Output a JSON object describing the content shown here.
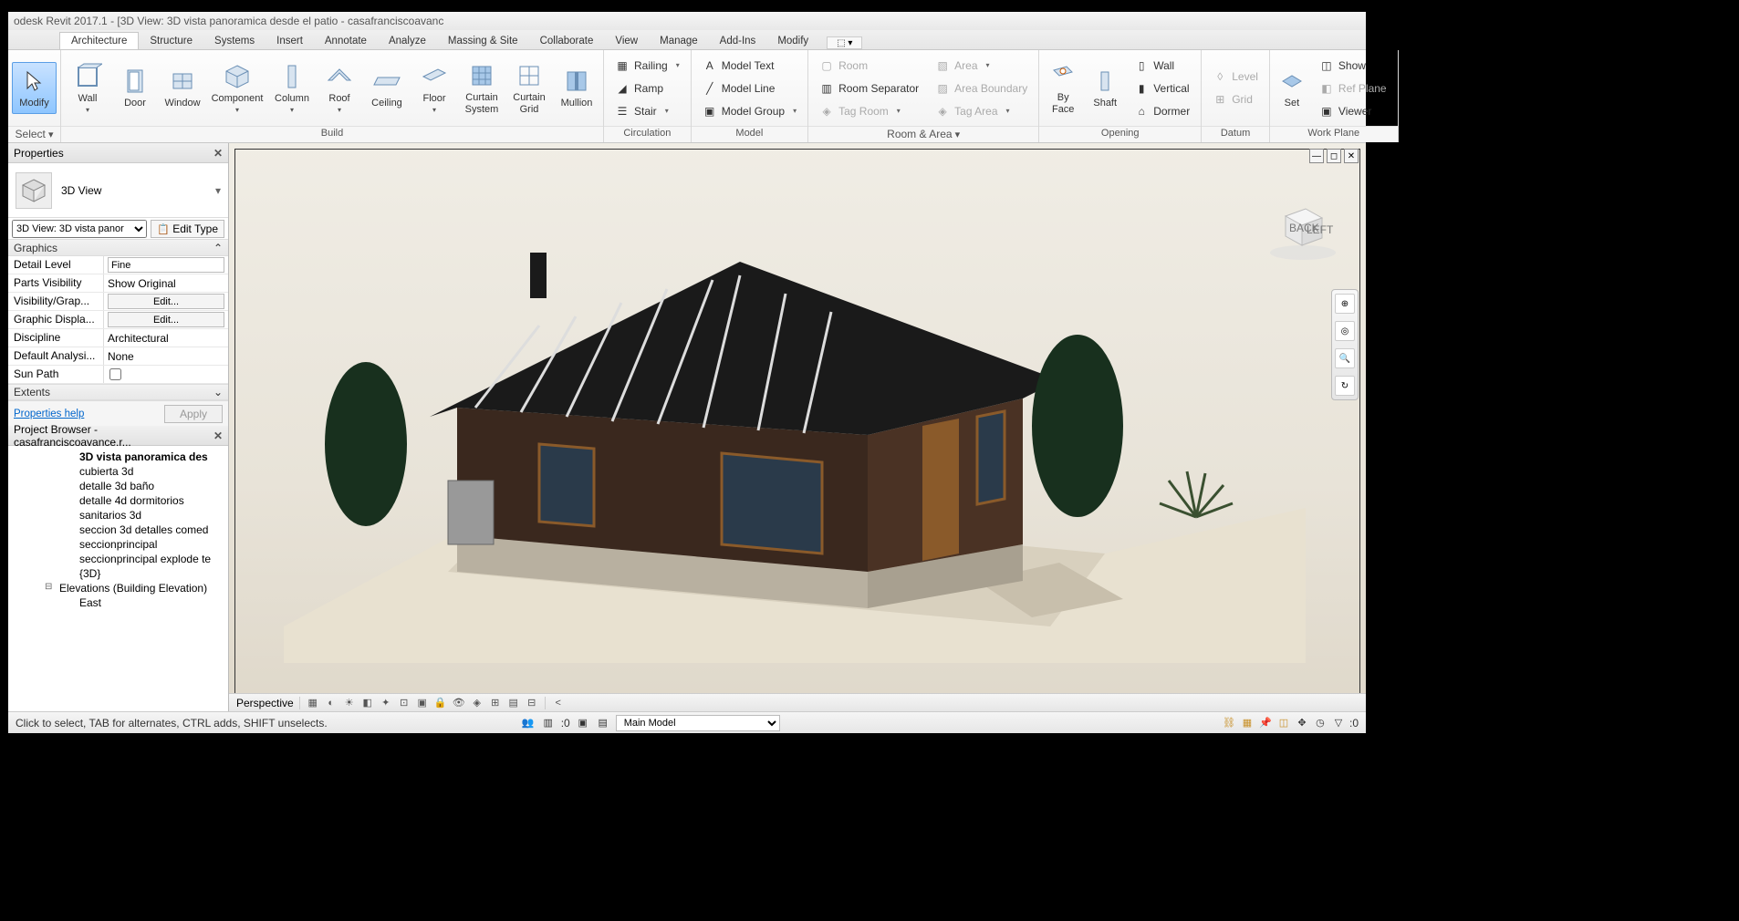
{
  "titlebar": "odesk Revit 2017.1 - [3D View: 3D vista panoramica desde el patio - casafranciscoavanc",
  "tabs": [
    "Architecture",
    "Structure",
    "Systems",
    "Insert",
    "Annotate",
    "Analyze",
    "Massing & Site",
    "Collaborate",
    "View",
    "Manage",
    "Add-Ins",
    "Modify"
  ],
  "active_tab": 0,
  "ribbon": {
    "select": {
      "modify": "Modify",
      "select": "Select"
    },
    "panels": [
      {
        "label": "Build",
        "items": [
          {
            "t": "big",
            "lbl": "Wall",
            "dd": true
          },
          {
            "t": "big",
            "lbl": "Door"
          },
          {
            "t": "big",
            "lbl": "Window"
          },
          {
            "t": "big",
            "lbl": "Component",
            "dd": true
          },
          {
            "t": "big",
            "lbl": "Column",
            "dd": true
          },
          {
            "t": "big",
            "lbl": "Roof",
            "dd": true
          },
          {
            "t": "big",
            "lbl": "Ceiling"
          },
          {
            "t": "big",
            "lbl": "Floor",
            "dd": true
          },
          {
            "t": "big",
            "lbl": "Curtain System"
          },
          {
            "t": "big",
            "lbl": "Curtain Grid"
          },
          {
            "t": "big",
            "lbl": "Mullion"
          }
        ]
      },
      {
        "label": "Circulation",
        "items": [
          {
            "t": "sm",
            "lbl": "Railing",
            "dd": true
          },
          {
            "t": "sm",
            "lbl": "Ramp"
          },
          {
            "t": "sm",
            "lbl": "Stair",
            "dd": true
          }
        ]
      },
      {
        "label": "Model",
        "items": [
          {
            "t": "sm",
            "lbl": "Model Text"
          },
          {
            "t": "sm",
            "lbl": "Model Line"
          },
          {
            "t": "sm",
            "lbl": "Model Group",
            "dd": true
          }
        ]
      },
      {
        "label": "Room & Area",
        "dd": true,
        "items": [
          {
            "t": "sm",
            "lbl": "Room",
            "disabled": true
          },
          {
            "t": "sm",
            "lbl": "Room Separator"
          },
          {
            "t": "sm",
            "lbl": "Tag Room",
            "dd": true,
            "disabled": true
          },
          {
            "t": "sm",
            "lbl": "Area",
            "dd": true,
            "disabled": true
          },
          {
            "t": "sm",
            "lbl": "Area Boundary",
            "disabled": true
          },
          {
            "t": "sm",
            "lbl": "Tag Area",
            "dd": true,
            "disabled": true
          }
        ],
        "cols": 2
      },
      {
        "label": "Opening",
        "items": [
          {
            "t": "big",
            "lbl": "By Face"
          },
          {
            "t": "big",
            "lbl": "Shaft"
          },
          {
            "t": "sm",
            "lbl": "Wall"
          },
          {
            "t": "sm",
            "lbl": "Vertical"
          },
          {
            "t": "sm",
            "lbl": "Dormer"
          }
        ],
        "mixed": true
      },
      {
        "label": "Datum",
        "items": [
          {
            "t": "sm",
            "lbl": "Level",
            "disabled": true
          },
          {
            "t": "sm",
            "lbl": "Grid",
            "disabled": true
          }
        ]
      },
      {
        "label": "Work Plane",
        "items": [
          {
            "t": "big",
            "lbl": "Set"
          },
          {
            "t": "sm",
            "lbl": "Show"
          },
          {
            "t": "sm",
            "lbl": "Ref Plane",
            "disabled": true
          },
          {
            "t": "sm",
            "lbl": "Viewer"
          }
        ],
        "mixed": true
      }
    ]
  },
  "properties": {
    "title": "Properties",
    "type": "3D View",
    "instance": "3D View: 3D vista panor",
    "edit_type": "Edit Type",
    "graphics_cat": "Graphics",
    "rows": [
      {
        "k": "Detail Level",
        "v": "Fine",
        "kind": "text"
      },
      {
        "k": "Parts Visibility",
        "v": "Show Original",
        "kind": "plain"
      },
      {
        "k": "Visibility/Grap...",
        "v": "Edit...",
        "kind": "btn"
      },
      {
        "k": "Graphic Displa...",
        "v": "Edit...",
        "kind": "btn"
      },
      {
        "k": "Discipline",
        "v": "Architectural",
        "kind": "plain"
      },
      {
        "k": "Default Analysi...",
        "v": "None",
        "kind": "plain"
      },
      {
        "k": "Sun Path",
        "v": "",
        "kind": "check"
      }
    ],
    "extents_cat": "Extents",
    "help": "Properties help",
    "apply": "Apply"
  },
  "browser": {
    "title": "Project Browser - casafranciscoavance.r...",
    "items": [
      {
        "lbl": "3D vista panoramica des",
        "bold": true
      },
      {
        "lbl": "cubierta 3d"
      },
      {
        "lbl": "detalle 3d baño"
      },
      {
        "lbl": "detalle 4d dormitorios"
      },
      {
        "lbl": "sanitarios 3d"
      },
      {
        "lbl": "seccion 3d detalles comed"
      },
      {
        "lbl": "seccionprincipal"
      },
      {
        "lbl": "seccionprincipal explode te"
      },
      {
        "lbl": "{3D}"
      }
    ],
    "cat": "Elevations (Building Elevation)",
    "cat_items": [
      "East"
    ]
  },
  "viewport": {
    "label": "Perspective",
    "viewcube": {
      "back": "BACK",
      "left": "LEFT"
    }
  },
  "status": {
    "hint": "Click to select, TAB for alternates, CTRL adds, SHIFT unselects.",
    "zero": ":0",
    "workset": "Main Model",
    "filter_count": ":0"
  }
}
